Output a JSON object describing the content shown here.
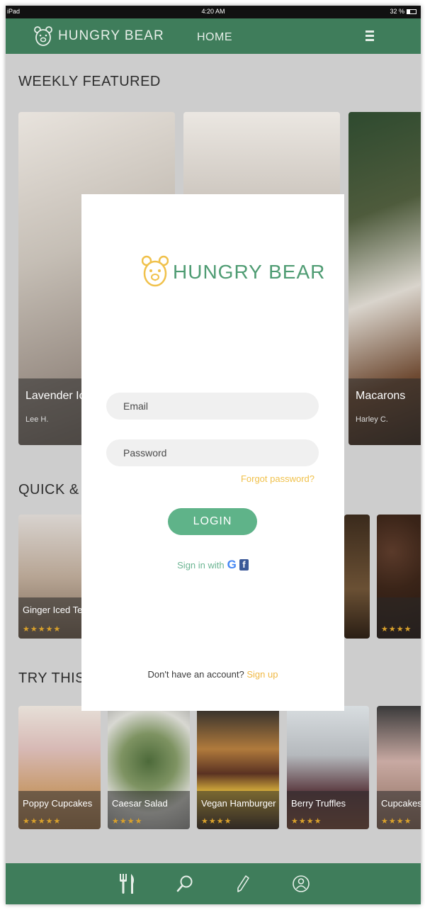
{
  "status_bar": {
    "carrier": "iPad",
    "time": "4:20 AM",
    "battery": "32 %"
  },
  "navbar": {
    "brand": "HUNGRY BEAR",
    "home": "HOME"
  },
  "sections": {
    "weekly": "WEEKLY FEATURED",
    "quick": "QUICK & SIMPLE",
    "try_this": "TRY THIS RECIPE"
  },
  "featured": [
    {
      "title": "Lavender Iced Latte",
      "author": "Lee H."
    },
    {
      "title": "",
      "author": ""
    },
    {
      "title": "Macarons",
      "author": "Harley C."
    }
  ],
  "quick_items": [
    {
      "title": "Ginger Iced Tea",
      "rating": "★★★★★"
    },
    {
      "title": "",
      "rating": ""
    },
    {
      "title": "",
      "rating": "★★★★"
    }
  ],
  "recipes": [
    {
      "title": "Poppy Cupcakes",
      "rating": "★★★★★"
    },
    {
      "title": "Caesar Salad",
      "rating": "★★★★"
    },
    {
      "title": "Vegan Hamburger",
      "rating": "★★★★"
    },
    {
      "title": "Berry Truffles",
      "rating": "★★★★"
    },
    {
      "title": "Cupcakes",
      "rating": "★★★★"
    }
  ],
  "login": {
    "brand": "HUNGRY BEAR",
    "email_placeholder": "Email",
    "password_placeholder": "Password",
    "forgot": "Forgot password?",
    "login_button": "LOGIN",
    "sign_in_with": "Sign in with",
    "no_account": "Don't have an account?",
    "sign_up": "Sign up"
  },
  "icons": {
    "google": "google-icon",
    "facebook": "facebook-icon",
    "tabs": [
      "utensils-icon",
      "search-icon",
      "pencil-icon",
      "profile-icon"
    ]
  },
  "colors": {
    "primary_green": "#3f7d5b",
    "button_green": "#5fb389",
    "accent_yellow": "#f0c14b",
    "star_gold": "#d9a12b"
  }
}
